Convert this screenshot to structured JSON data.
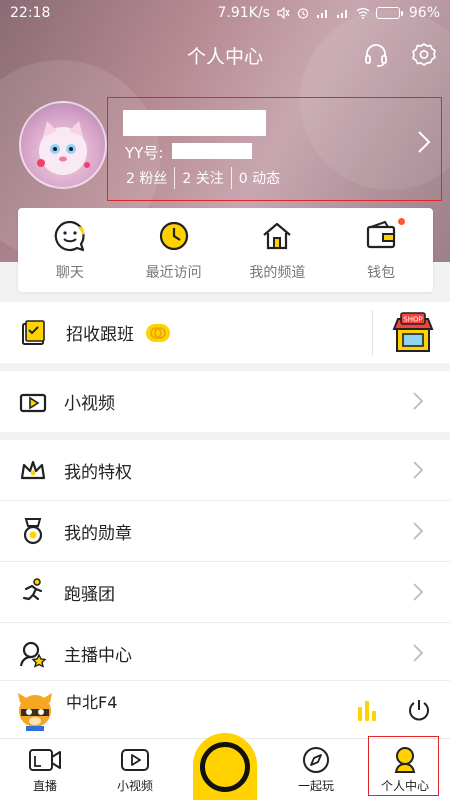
{
  "status_bar": {
    "time": "22:18",
    "net_speed": "7.91K/s",
    "battery": "96%"
  },
  "header": {
    "title": "个人中心"
  },
  "profile": {
    "yy_label": "YY号:",
    "stats": [
      {
        "label": "2 粉丝"
      },
      {
        "label": "2 关注"
      },
      {
        "label": "0 动态"
      }
    ]
  },
  "quick_actions": [
    {
      "label": "聊天",
      "icon": "chat-icon"
    },
    {
      "label": "最近访问",
      "icon": "clock-icon"
    },
    {
      "label": "我的频道",
      "icon": "home-icon"
    },
    {
      "label": "钱包",
      "icon": "wallet-icon"
    }
  ],
  "menu": {
    "recruit": {
      "label": "招收跟班",
      "icon": "recruit-icon",
      "shop_icon": "shop-icon",
      "shop_text": "SHOP"
    },
    "short_video": {
      "label": "小视频",
      "icon": "video-icon"
    },
    "items": [
      {
        "label": "我的特权",
        "icon": "crown-icon"
      },
      {
        "label": "我的勋章",
        "icon": "medal-icon"
      },
      {
        "label": "跑骚团",
        "icon": "runner-icon"
      },
      {
        "label": "主播中心",
        "icon": "anchor-star-icon"
      }
    ]
  },
  "player": {
    "name": "中北F4"
  },
  "bottom_nav": [
    {
      "label": "直播",
      "icon": "live-icon"
    },
    {
      "label": "小视频",
      "icon": "short-video-icon"
    },
    {
      "label": "",
      "icon": "center-ring-icon"
    },
    {
      "label": "一起玩",
      "icon": "compass-icon"
    },
    {
      "label": "个人中心",
      "icon": "profile-icon"
    }
  ],
  "colors": {
    "accent_yellow": "#ffd200",
    "highlight_red": "#e0262b",
    "badge_red": "#ff5a2c"
  }
}
